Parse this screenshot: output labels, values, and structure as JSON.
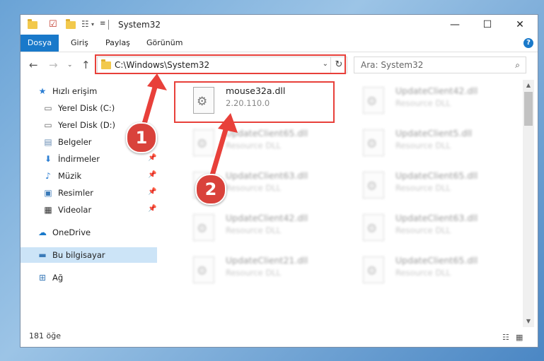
{
  "window": {
    "title": "System32"
  },
  "ribbon": {
    "tabs": [
      "Dosya",
      "Giriş",
      "Paylaş",
      "Görünüm"
    ],
    "help": "?"
  },
  "address": {
    "path": "C:\\Windows\\System32"
  },
  "search": {
    "placeholder": "Ara: System32"
  },
  "sidebar": {
    "items": [
      {
        "label": "Hızlı erişim",
        "icon": "star-icon",
        "pinned": false
      },
      {
        "label": "Yerel Disk (C:)",
        "icon": "drive-icon",
        "pinned": false
      },
      {
        "label": "Yerel Disk (D:)",
        "icon": "drive-icon",
        "pinned": false
      },
      {
        "label": "Belgeler",
        "icon": "documents-icon",
        "pinned": true
      },
      {
        "label": "İndirmeler",
        "icon": "download-icon",
        "pinned": true
      },
      {
        "label": "Müzik",
        "icon": "music-icon",
        "pinned": true
      },
      {
        "label": "Resimler",
        "icon": "pictures-icon",
        "pinned": true
      },
      {
        "label": "Videolar",
        "icon": "video-icon",
        "pinned": true
      },
      {
        "label": "OneDrive",
        "icon": "cloud-icon",
        "pinned": false
      },
      {
        "label": "Bu bilgisayar",
        "icon": "computer-icon",
        "pinned": false
      },
      {
        "label": "Ağ",
        "icon": "network-icon",
        "pinned": false
      }
    ]
  },
  "files": [
    {
      "name": "mouse32a.dll",
      "sub": "2.20.110.0"
    },
    {
      "name": "UpdateClient42.dll",
      "sub": "Resource DLL"
    },
    {
      "name": "UpdateClient65.dll",
      "sub": "Resource DLL"
    },
    {
      "name": "UpdateClient5.dll",
      "sub": "Resource DLL"
    },
    {
      "name": "UpdateClient63.dll",
      "sub": "Resource DLL"
    },
    {
      "name": "UpdateClient65.dll",
      "sub": "Resource DLL"
    },
    {
      "name": "UpdateClient42.dll",
      "sub": "Resource DLL"
    },
    {
      "name": "UpdateClient63.dll",
      "sub": "Resource DLL"
    },
    {
      "name": "UpdateClient21.dll",
      "sub": "Resource DLL"
    },
    {
      "name": "UpdateClient65.dll",
      "sub": "Resource DLL"
    }
  ],
  "status": {
    "count": "181 öğe"
  },
  "annotations": {
    "step1": "1",
    "step2": "2"
  },
  "colors": {
    "accent": "#1979ca",
    "annotation": "#e8403a"
  }
}
